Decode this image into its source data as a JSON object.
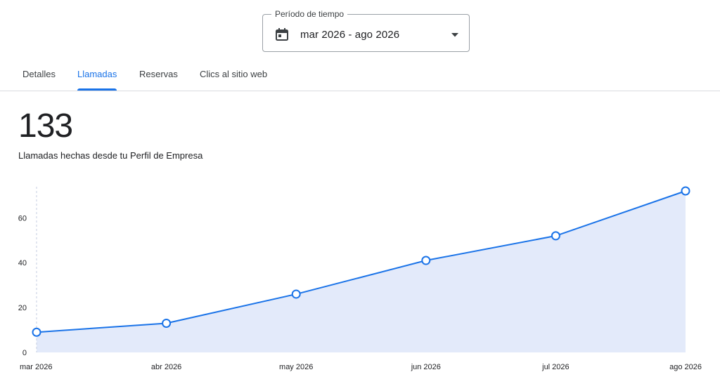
{
  "period": {
    "label": "Período de tiempo",
    "value": "mar 2026 - ago 2026",
    "icon": "calendar-icon"
  },
  "tabs": [
    {
      "label": "Detalles",
      "active": false
    },
    {
      "label": "Llamadas",
      "active": true
    },
    {
      "label": "Reservas",
      "active": false
    },
    {
      "label": "Clics al sitio web",
      "active": false
    }
  ],
  "summary": {
    "total": "133",
    "description": "Llamadas hechas desde tu Perfil de Empresa"
  },
  "colors": {
    "accent": "#1a73e8",
    "area": "#e3eafa"
  },
  "chart_data": {
    "type": "area",
    "categories": [
      "mar 2026",
      "abr 2026",
      "may 2026",
      "jun 2026",
      "jul 2026",
      "ago 2026"
    ],
    "series": [
      {
        "values": [
          9,
          13,
          26,
          41,
          52,
          72
        ]
      }
    ],
    "yticks": [
      0,
      20,
      40,
      60
    ],
    "ylim": [
      0,
      72
    ],
    "markers": "hollow-circle",
    "grid": false
  }
}
